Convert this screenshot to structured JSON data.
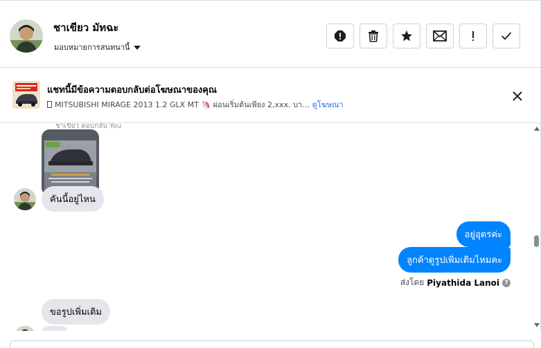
{
  "header": {
    "contact_name": "ชาเขียว มัทฉะ",
    "assign_label": "มอบหมายการสนทนานี้",
    "tools": [
      "mark-spam-icon",
      "delete-icon",
      "star-icon",
      "unread-icon",
      "follow-up-icon",
      "done-icon"
    ]
  },
  "ad": {
    "title": "แชทนี้มีข้อความตอบกลับต่อโฆษณาของคุณ",
    "subtitle": "MITSUBISHI MIRAGE 2013 1.2 GLX MT 🦄 ผ่อนเริ่มต้นเพียง 2,xxx. บา...",
    "link": "ดูโฆษณา"
  },
  "conversation": {
    "faint_label": "ชาเขียว ตอบกลับ You",
    "messages": [
      {
        "from": "customer",
        "text": "คันนี้อยู่ไหน"
      },
      {
        "from": "page",
        "text": "อยู่อุดรค่ะ"
      },
      {
        "from": "page",
        "text": "ลูกค้าดูรูปเพิ่มเติมไหมคะ"
      },
      {
        "from": "customer",
        "text": "ขอรูปเพิ่มเติม"
      }
    ],
    "sent_by_prefix": "ส่งโดย",
    "sent_by_name": "Piyathida Lanoi",
    "help_glyph": "?"
  },
  "colors": {
    "accent": "#0084ff",
    "link": "#216fdb",
    "bubble_in": "#e4e6eb"
  }
}
